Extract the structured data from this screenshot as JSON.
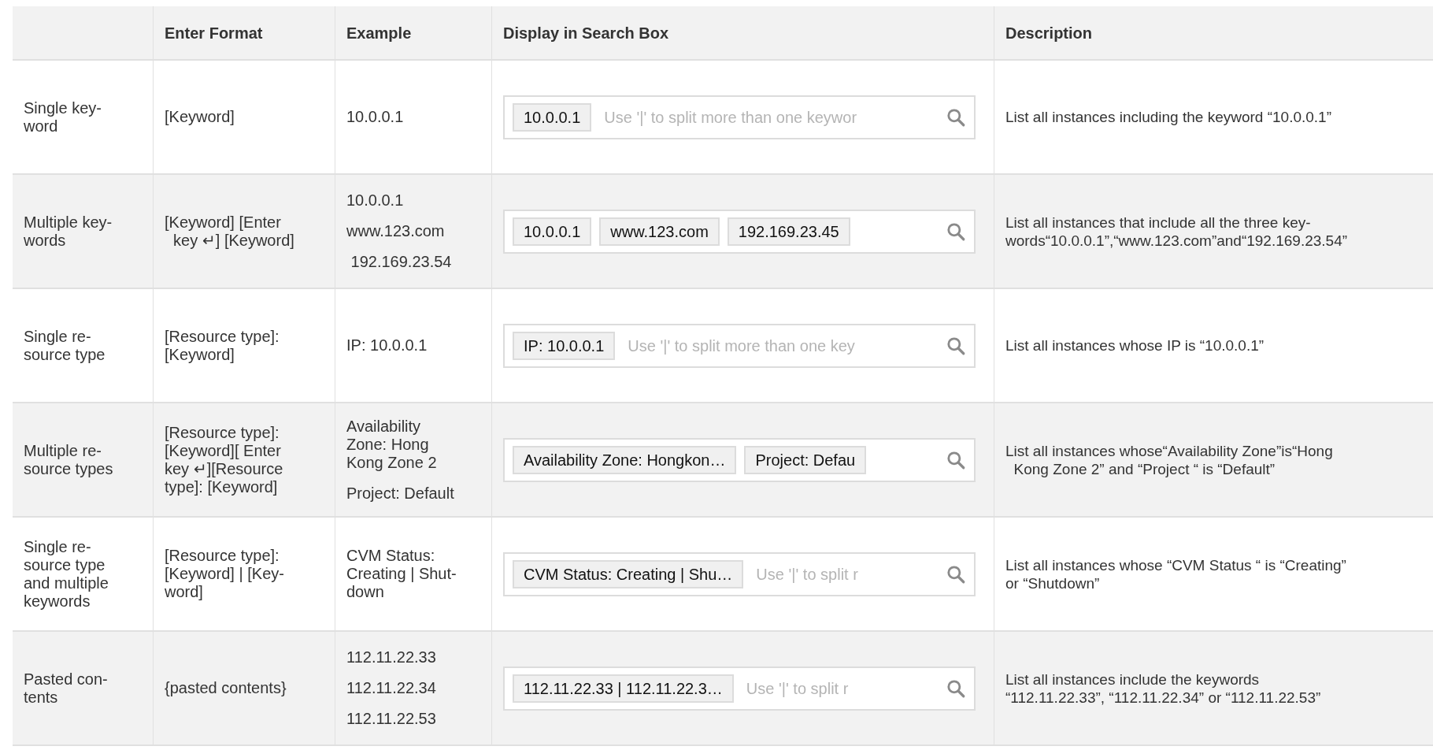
{
  "table": {
    "columns": [
      "",
      "Enter Format",
      "Example",
      "Display in Search Box",
      "Description"
    ],
    "rows": [
      {
        "case": "Single key-\nword",
        "format": "[Keyword]",
        "example": [
          "10.0.0.1"
        ],
        "search_box": {
          "chips": [
            "10.0.0.1"
          ],
          "placeholder": "Use '|' to split more than one keywor"
        },
        "description": "List all instances including the keyword “10.0.0.1”"
      },
      {
        "case": "Multiple key-\nwords",
        "format": "[Keyword] [Enter\n  key ↵] [Keyword]",
        "example": [
          "10.0.0.1",
          "www.123.com",
          " 192.169.23.54"
        ],
        "search_box": {
          "chips": [
            "10.0.0.1",
            "www.123.com",
            "192.169.23.45"
          ]
        },
        "description": "List all instances that include all the three key-\nwords“10.0.0.1”,“www.123.com”and“192.169.23.54”"
      },
      {
        "case": "Single re-\nsource type",
        "format": "[Resource type]:\n[Keyword]",
        "example": [
          "IP: 10.0.0.1"
        ],
        "search_box": {
          "chips": [
            "IP: 10.0.0.1"
          ],
          "placeholder": "Use '|' to split more than one key"
        },
        "description": "List all instances whose IP is “10.0.0.1”"
      },
      {
        "case": "Multiple re-\nsource types",
        "format": "[Resource type]:\n[Keyword][ Enter\nkey ↵][Resource\ntype]: [Keyword]",
        "example": [
          "Availability\nZone: Hong\nKong Zone 2",
          "Project: Default"
        ],
        "search_box": {
          "chips": [
            "Availability Zone: Hongkon…",
            "Project: Defau"
          ]
        },
        "description": "List all instances whose“Availability Zone”is“Hong\n  Kong Zone 2” and “Project “ is “Default”"
      },
      {
        "case": "Single re-\nsource type\nand multiple\nkeywords",
        "format": "[Resource type]:\n[Keyword] | [Key-\nword]",
        "example": [
          "CVM Status:\nCreating | Shut-\ndown"
        ],
        "search_box": {
          "chips": [
            "CVM Status: Creating | Shu…"
          ],
          "placeholder": "Use '|' to split r"
        },
        "description": "List all instances whose “CVM Status “ is “Creating”\nor “Shutdown”"
      },
      {
        "case": "Pasted con-\ntents",
        "format": "{pasted contents}",
        "example": [
          "112.11.22.33",
          "112.11.22.34",
          "112.11.22.53"
        ],
        "search_box": {
          "chips": [
            "112.11.22.33 | 112.11.22.3…"
          ],
          "placeholder": "Use '|' to split r"
        },
        "description": "List all instances include the keywords\n“112.11.22.33”, “112.11.22.34” or “112.11.22.53”"
      }
    ]
  }
}
